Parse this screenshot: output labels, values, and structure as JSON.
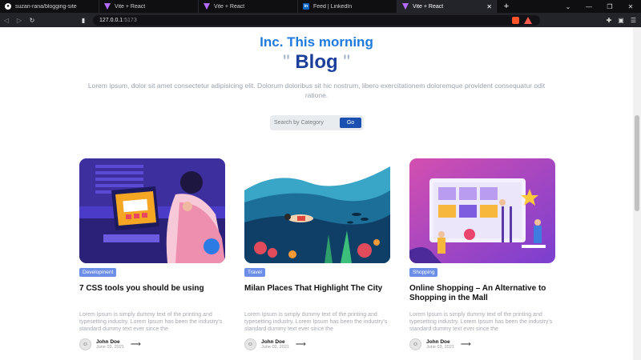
{
  "browser": {
    "tabs": [
      {
        "label": "suzan-rana/blogging-site",
        "icon": "github-icon",
        "active": false
      },
      {
        "label": "Vite + React",
        "icon": "vite-icon",
        "active": false
      },
      {
        "label": "Vite + React",
        "icon": "vite-icon",
        "active": false
      },
      {
        "label": "Feed | LinkedIn",
        "icon": "linkedin-icon",
        "active": false
      },
      {
        "label": "Vite + React",
        "icon": "vite-icon",
        "active": true
      }
    ],
    "url_host": "127.0.0.1",
    "url_port": ":5173"
  },
  "hero": {
    "subtitle": "Inc. This morning",
    "title": "Blog",
    "quote_open": "\"",
    "quote_close": "\"",
    "intro": "Lorem ipsum, dolor sit amet consectetur adipisicing elit. Dolorum doloribus sit hic nostrum, libero exercitationem doloremque provident consequatur odit ratione."
  },
  "search": {
    "placeholder": "Search by Category",
    "button": "Go"
  },
  "posts": [
    {
      "category": "Development",
      "title": "7 CSS tools you should be using",
      "excerpt": "Lorem Ipsum is simply dummy text of the printing and typesetting industry. Lorem Ipsum has been the industry's standard dummy text ever since the",
      "author": "John Doe",
      "date": "June 03, 2021"
    },
    {
      "category": "Travel",
      "title": "Milan Places That Highlight The City",
      "excerpt": "Lorem Ipsum is simply dummy text of the printing and typesetting industry. Lorem Ipsum has been the industry's standard dummy text ever since the",
      "author": "John Doe",
      "date": "June 03, 2021"
    },
    {
      "category": "Shopping",
      "title": "Online Shopping – An Alternative to Shopping in the Mall",
      "excerpt": "Lorem Ipsum is simply dummy text of the printing and typesetting industry. Lorem Ipsum has been the industry's standard dummy text ever since the",
      "author": "John Doe",
      "date": "June 03, 2021"
    }
  ],
  "colors": {
    "accent": "#1f7ae0",
    "title": "#1b3f9a",
    "tag": "#6d8ee8",
    "button": "#1b4fb0"
  }
}
